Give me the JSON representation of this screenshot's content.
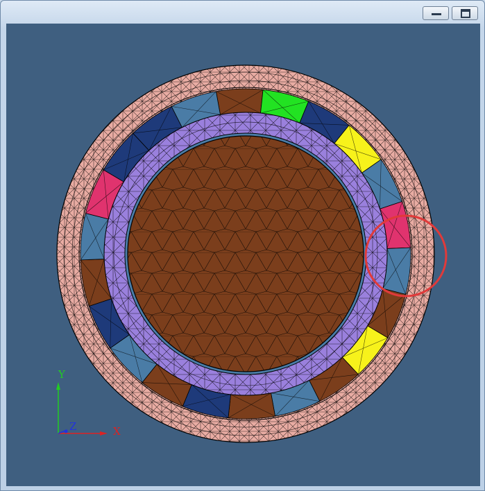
{
  "window": {
    "title": "",
    "controls": [
      "minimize",
      "maximize"
    ]
  },
  "viewer": {
    "background_color": "#3f5f80",
    "outer_ring_color": "#e9aca3",
    "cage_color": "#9a80dd",
    "inner_core_color": "#7b3e1c",
    "roller_colors": [
      "#7b3e1c",
      "#1e3a7a",
      "#4a7ca6",
      "#f7f21b",
      "#e0336e",
      "#22e222"
    ],
    "highlight_color": "#e03a3a",
    "highlight_marker": "red-circle"
  },
  "axes_triad": {
    "y_label": "Y",
    "z_label": "Z",
    "x_label": "X",
    "y_color": "#22cc22",
    "z_color": "#2233dd",
    "x_color": "#dd2222"
  }
}
